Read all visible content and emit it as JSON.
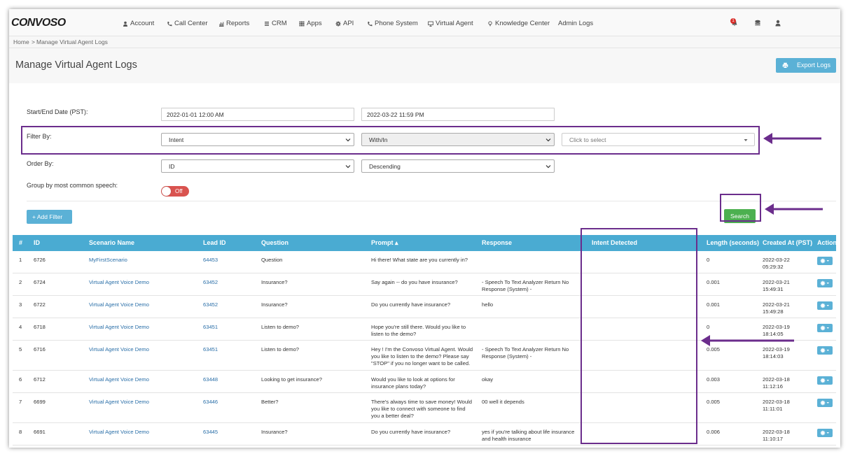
{
  "app": {
    "logo": "CONVOSO"
  },
  "nav": {
    "items": [
      {
        "label": "Account",
        "icon": "user-icon"
      },
      {
        "label": "Call Center",
        "icon": "phone-icon"
      },
      {
        "label": "Reports",
        "icon": "bar-chart-icon"
      },
      {
        "label": "CRM",
        "icon": "list-icon"
      },
      {
        "label": "Apps",
        "icon": "grid-icon"
      },
      {
        "label": "API",
        "icon": "gear-icon"
      },
      {
        "label": "Phone System",
        "icon": "phone-icon"
      },
      {
        "label": "Virtual Agent",
        "icon": "monitor-icon"
      },
      {
        "label": "Knowledge Center",
        "icon": "lightbulb-icon"
      },
      {
        "label": "Admin Logs",
        "icon": ""
      }
    ]
  },
  "topright": {
    "notification_count": "1",
    "icons": [
      "bell-icon",
      "database-icon",
      "user-icon"
    ]
  },
  "breadcrumb": {
    "home": "Home",
    "sep": ">",
    "current": "Manage Virtual Agent Logs"
  },
  "page": {
    "title": "Manage Virtual Agent Logs",
    "export_label": "Export Logs"
  },
  "form": {
    "date_label": "Start/End Date (PST):",
    "start_date": "2022-01-01 12:00 AM",
    "end_date": "2022-03-22 11:59 PM",
    "filter_label": "Filter By:",
    "filter_field": "Intent",
    "filter_operator": "With/In",
    "filter_value_placeholder": "Click to select",
    "order_label": "Order By:",
    "order_field": "ID",
    "order_direction": "Descending",
    "group_label": "Group by most common speech:",
    "group_toggle": "Off",
    "add_filter_label": "+ Add Filter",
    "search_label": "Search"
  },
  "table": {
    "columns": [
      "#",
      "ID",
      "Scenario Name",
      "Lead ID",
      "Question",
      "Prompt ▴",
      "Response",
      "Intent Detected",
      "Length (seconds)",
      "Created At (PST)",
      "Action"
    ],
    "rows": [
      {
        "n": "1",
        "id": "6726",
        "scenario": "MyFirstScenario",
        "lead": "64453",
        "question": "Question",
        "prompt": [
          "Hi there! What state are you currently in?"
        ],
        "response": [],
        "intent": "",
        "length": "0",
        "created": [
          "2022-03-22",
          "05:29:32"
        ]
      },
      {
        "n": "2",
        "id": "6724",
        "scenario": "Virtual Agent Voice Demo",
        "lead": "63452",
        "question": "Insurance?",
        "prompt": [
          "Say again -- do you have insurance?"
        ],
        "response": [
          "- Speech To Text Analyzer Return No",
          "Response (System) -"
        ],
        "intent": "",
        "length": "0.001",
        "created": [
          "2022-03-21",
          "15:49:31"
        ]
      },
      {
        "n": "3",
        "id": "6722",
        "scenario": "Virtual Agent Voice Demo",
        "lead": "63452",
        "question": "Insurance?",
        "prompt": [
          "Do you currently have insurance?"
        ],
        "response": [
          "hello"
        ],
        "intent": "",
        "length": "0.001",
        "created": [
          "2022-03-21",
          "15:49:28"
        ]
      },
      {
        "n": "4",
        "id": "6718",
        "scenario": "Virtual Agent Voice Demo",
        "lead": "63451",
        "question": "Listen to demo?",
        "prompt": [
          "Hope you're still there. Would you like to",
          "listen to the demo?"
        ],
        "response": [],
        "intent": "",
        "length": "0",
        "created": [
          "2022-03-19",
          "18:14:05"
        ]
      },
      {
        "n": "5",
        "id": "6716",
        "scenario": "Virtual Agent Voice Demo",
        "lead": "63451",
        "question": "Listen to demo?",
        "prompt": [
          "Hey ! I'm the Convoso Virtual Agent. Would",
          "you like to listen to the demo? Please say",
          "\"STOP\" if you no longer want to be called."
        ],
        "response": [
          "- Speech To Text Analyzer Return No",
          "Response (System) -"
        ],
        "intent": "",
        "length": "0.005",
        "created": [
          "2022-03-19",
          "18:14:03"
        ]
      },
      {
        "n": "6",
        "id": "6712",
        "scenario": "Virtual Agent Voice Demo",
        "lead": "63448",
        "question": "Looking to get insurance?",
        "prompt": [
          "Would you like to look at options for",
          "insurance plans today?"
        ],
        "response": [
          "okay"
        ],
        "intent": "",
        "length": "0.003",
        "created": [
          "2022-03-18",
          "11:12:16"
        ]
      },
      {
        "n": "7",
        "id": "6699",
        "scenario": "Virtual Agent Voice Demo",
        "lead": "63446",
        "question": "Better?",
        "prompt": [
          "There's always time to save money! Would",
          "you like to connect with someone to find",
          "you a better deal?"
        ],
        "response": [
          "00 well it depends"
        ],
        "intent": "",
        "length": "0.005",
        "created": [
          "2022-03-18",
          "11:11:01"
        ]
      },
      {
        "n": "8",
        "id": "6691",
        "scenario": "Virtual Agent Voice Demo",
        "lead": "63445",
        "question": "Insurance?",
        "prompt": [
          "Do you currently have insurance?"
        ],
        "response": [
          "yes if you're talking about life insurance",
          "and health insurance"
        ],
        "intent": "",
        "length": "0.006",
        "created": [
          "2022-03-18",
          "11:10:17"
        ]
      }
    ]
  },
  "colors": {
    "accent": "#4aabd2",
    "button_blue": "#5bb1d6",
    "search_green": "#4cb050",
    "annotation": "#6b2d8c",
    "toggle_off": "#d9534f",
    "link": "#2a6fa8"
  }
}
